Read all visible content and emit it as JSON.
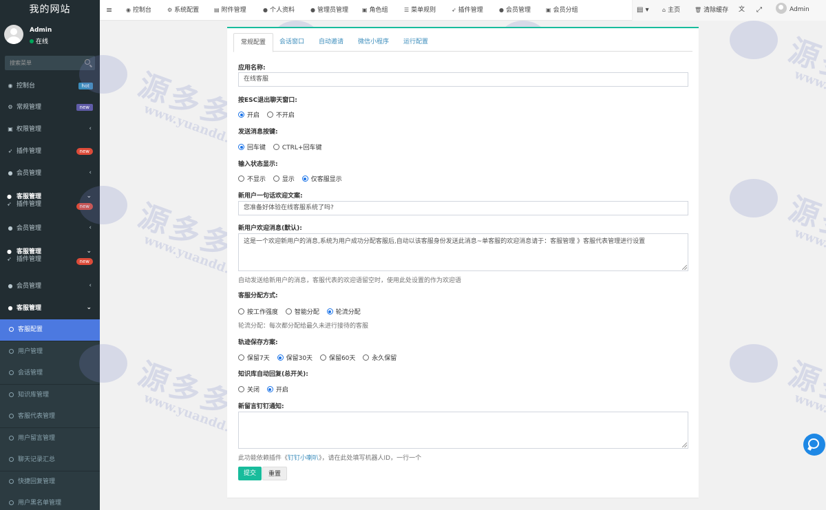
{
  "sidebar": {
    "logo": "我的网站",
    "user": {
      "name": "Admin",
      "status": "在线"
    },
    "search_placeholder": "搜索菜单",
    "items": [
      {
        "label": "控制台",
        "icon": "dashboard-icon",
        "badge": "hot"
      },
      {
        "label": "常规管理",
        "icon": "cogs-icon",
        "badge": "new"
      },
      {
        "label": "权限管理",
        "icon": "group-icon"
      },
      {
        "label": "插件管理",
        "icon": "rocket-icon",
        "badge": "new"
      },
      {
        "label": "会员管理",
        "icon": "user-circle-icon"
      },
      {
        "label": "客服管理",
        "label2": "插件管理",
        "icon": "comment-icon",
        "badge": "new"
      },
      {
        "label": "会员管理",
        "icon": "user-circle-icon"
      },
      {
        "label": "客服管理",
        "label2": "插件管理",
        "icon": "comment-icon",
        "badge": "new"
      },
      {
        "label": "会员管理",
        "icon": "user-circle-icon"
      },
      {
        "label": "客服管理",
        "icon": "comment-icon"
      }
    ],
    "sub_items": [
      "客服配置",
      "用户管理",
      "会话管理",
      "知识库管理",
      "客服代表管理",
      "用户留言管理",
      "聊天记录汇总",
      "快捷回复管理",
      "用户黑名单管理"
    ]
  },
  "topbar": {
    "nav": [
      "控制台",
      "系统配置",
      "附件管理",
      "个人资料",
      "管理员管理",
      "角色组",
      "菜单规则",
      "插件管理",
      "会员管理",
      "会员分组"
    ],
    "right": {
      "home": "主页",
      "clear_cache": "清除缓存",
      "user": "Admin"
    }
  },
  "tabs": [
    "常规配置",
    "会话窗口",
    "自动邀请",
    "微信小程序",
    "运行配置"
  ],
  "form": {
    "app_name_label": "应用名称:",
    "app_name_value": "在线客服",
    "esc_label": "按ESC退出聊天窗口:",
    "esc_options": [
      "开启",
      "不开启"
    ],
    "esc_selected": 0,
    "send_key_label": "发送消息按键:",
    "send_key_options": [
      "回车键",
      "CTRL+回车键"
    ],
    "send_key_selected": 0,
    "typing_label": "输入状态显示:",
    "typing_options": [
      "不显示",
      "显示",
      "仅客服显示"
    ],
    "typing_selected": 2,
    "welcome_label": "新用户一句话欢迎文案:",
    "welcome_value": "您准备好体验在线客服系统了吗?",
    "welcome_msg_label": "新用户欢迎消息(默认):",
    "welcome_msg_value": "这是一个欢迎新用户的消息,系统为用户成功分配客服后,自动以该客服身份发送此消息~单客服的欢迎消息请于：客服管理 》客服代表管理进行设置",
    "welcome_msg_help": "自动发送给新用户的消息，客服代表的欢迎语留空时，使用此处设置的作为欢迎语",
    "assign_label": "客服分配方式:",
    "assign_options": [
      "按工作强度",
      "智能分配",
      "轮流分配"
    ],
    "assign_selected": 2,
    "assign_help": "轮流分配：每次都分配给最久未进行接待的客服",
    "track_label": "轨迹保存方案:",
    "track_options": [
      "保留7天",
      "保留30天",
      "保留60天",
      "永久保留"
    ],
    "track_selected": 1,
    "kb_label": "知识库自动回复(总开关):",
    "kb_options": [
      "关闭",
      "开启"
    ],
    "kb_selected": 1,
    "dingtalk_label": "新留言钉钉通知:",
    "dingtalk_value": "",
    "dingtalk_help_pre": "此功能依赖插件《",
    "dingtalk_help_link": "钉钉小喇叭",
    "dingtalk_help_post": "》，请在此处填写机器人ID，一行一个",
    "submit": "提交",
    "reset": "重置"
  },
  "watermark": {
    "big": "源多多",
    "small": "www.yuandd.net"
  },
  "colors": {
    "primary": "#18bc9c",
    "sidebar_bg": "#222d32",
    "active": "#4c79e0",
    "link": "#3c8dbc"
  }
}
